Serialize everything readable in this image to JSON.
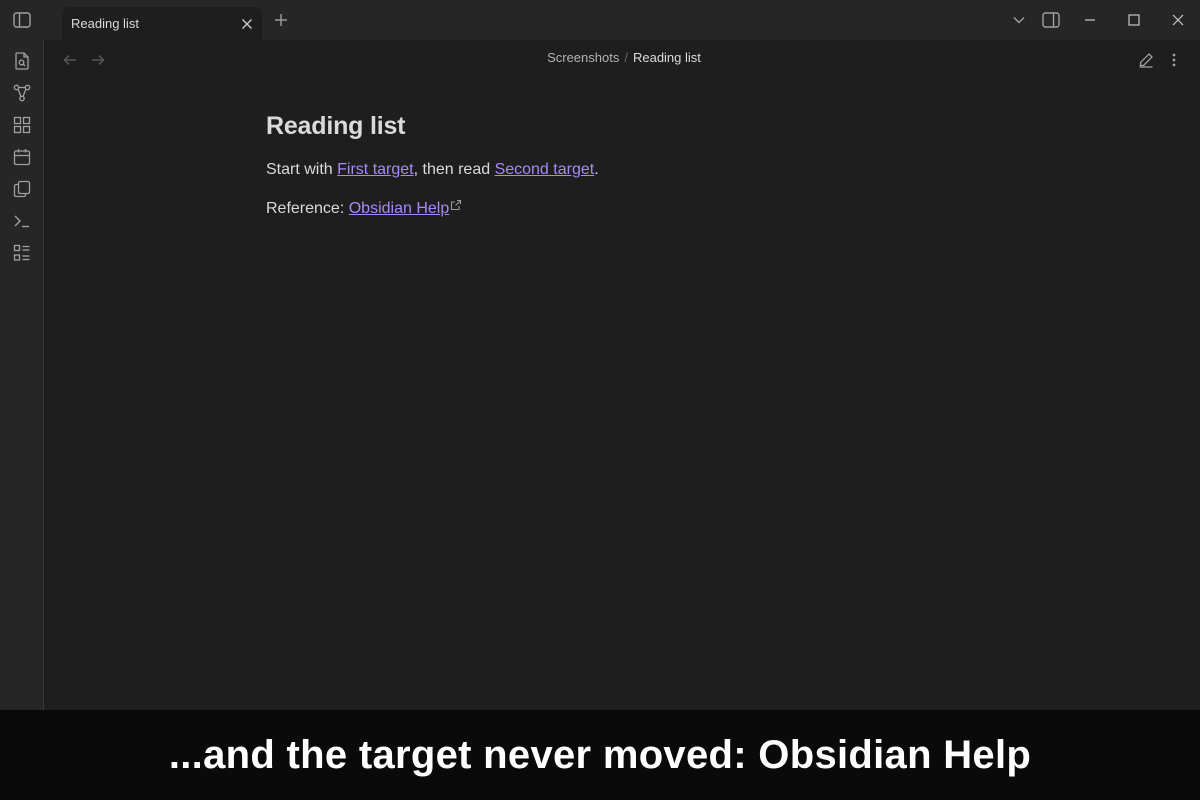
{
  "titlebar": {
    "tab": {
      "title": "Reading list"
    }
  },
  "header": {
    "breadcrumb": {
      "folder": "Screenshots",
      "separator": "/",
      "current": "Reading list"
    }
  },
  "note": {
    "title": "Reading list",
    "line1": {
      "prefix": "Start with ",
      "link1": "First target",
      "middle": ", then read ",
      "link2": "Second target",
      "suffix": "."
    },
    "line2": {
      "prefix": "Reference: ",
      "external_link": "Obsidian Help"
    }
  },
  "caption": {
    "text": "...and the target never moved: Obsidian Help"
  },
  "icons": {
    "sidebar_toggle": "sidebar-left-icon",
    "ribbon": [
      "file-search-icon",
      "graph-icon",
      "blocks-icon",
      "calendar-icon",
      "copy-icon",
      "terminal-icon",
      "list-checks-icon"
    ],
    "window": [
      "chevron-down-icon",
      "sidebar-right-icon",
      "minimize-icon",
      "maximize-icon",
      "close-icon"
    ],
    "view": [
      "edit-pencil-icon",
      "more-vertical-icon"
    ]
  },
  "colors": {
    "background": "#1e1e1e",
    "chrome": "#262626",
    "link": "#a68af9",
    "text": "#dadada",
    "caption_bg": "#0a0a0a"
  }
}
